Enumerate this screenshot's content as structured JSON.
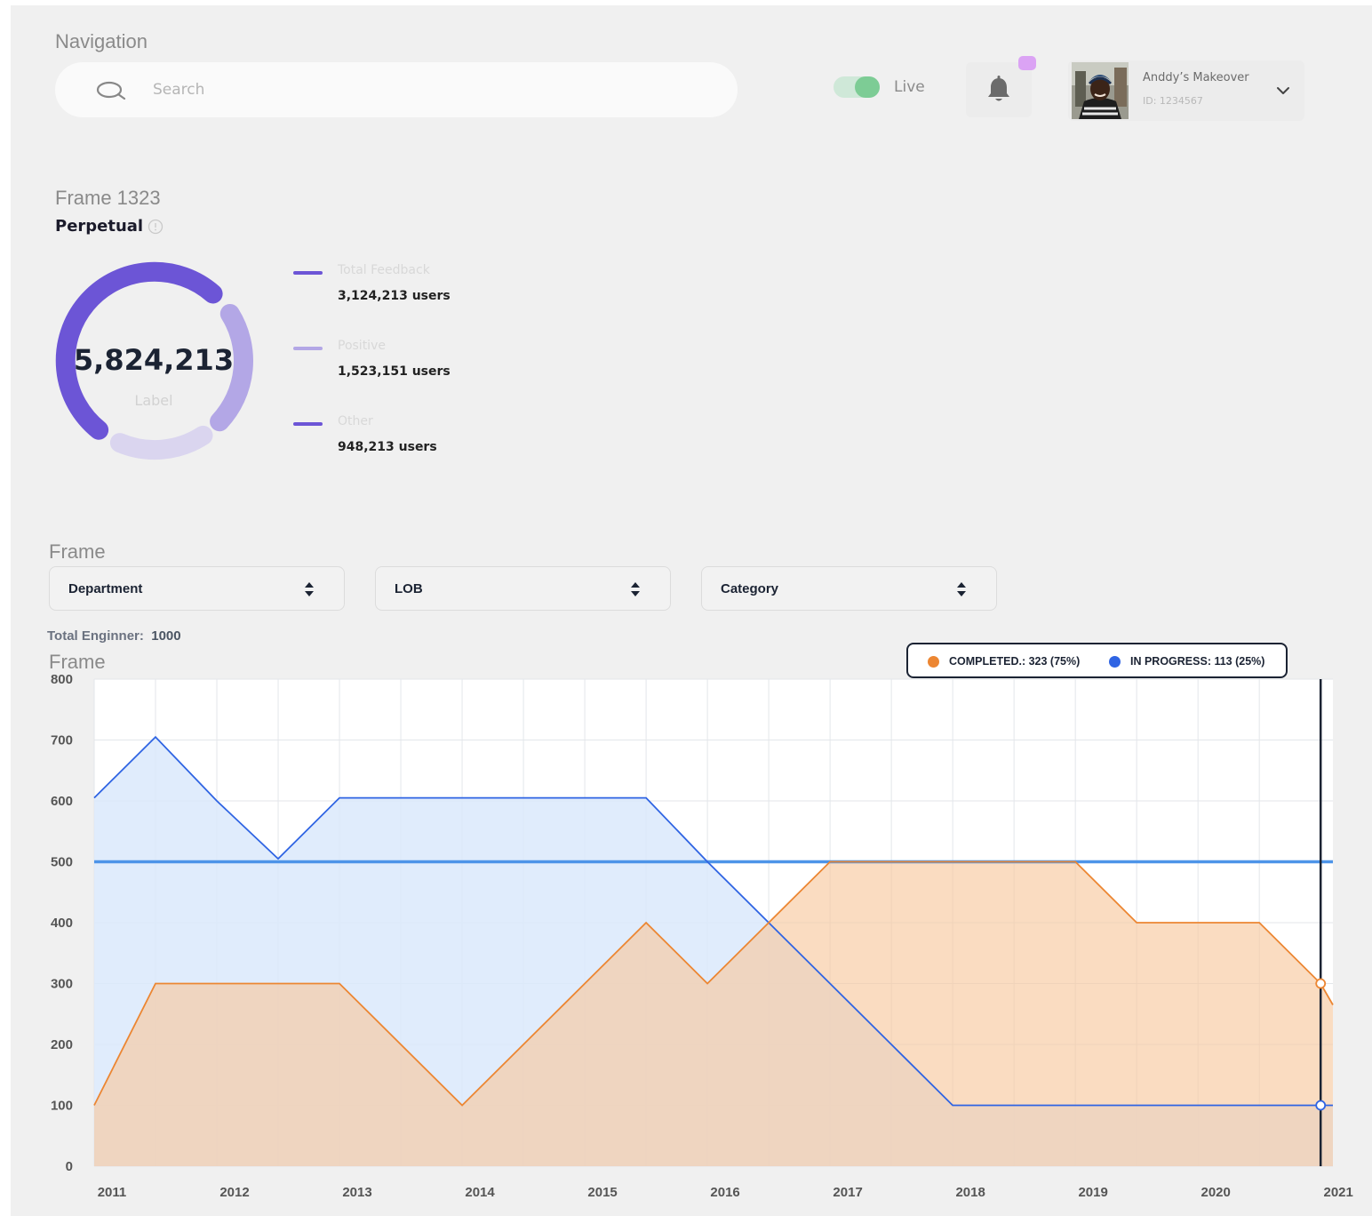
{
  "header": {
    "nav_title": "Navigation",
    "search_placeholder": "Search",
    "live_label": "Live",
    "toggle_on": true,
    "profile_name": "Anddy’s Makeover",
    "profile_id": "ID: 1234567"
  },
  "summary": {
    "title": "Frame 1323",
    "subtitle": "Perpetual",
    "total_value": "5,824,213",
    "total_label": "Label",
    "legend": [
      {
        "name": "Total Feedback",
        "value": "3,124,213 users",
        "color": "#6c55d6"
      },
      {
        "name": "Positive",
        "value": "1,523,151 users",
        "color": "#b3a7e6"
      },
      {
        "name": "Other",
        "value": "948,213 users",
        "color": "#6c55d6"
      }
    ],
    "ring_colors": [
      "#6c55d6",
      "#b3a7e6",
      "#dad5ef"
    ]
  },
  "filters": {
    "title": "Frame",
    "department": "Department",
    "lob": "LOB",
    "category": "Category"
  },
  "chart_section": {
    "total_label": "Total Enginner:",
    "total_value": "1000",
    "title": "Frame",
    "legend_completed": "COMPLETED.: 323 (75%)",
    "legend_in_progress": "IN PROGRESS: 113 (25%)"
  },
  "chart_data": {
    "type": "area",
    "xlabel": "",
    "ylabel": "",
    "ylim": [
      0,
      800
    ],
    "yticks": [
      0,
      100,
      200,
      300,
      400,
      500,
      600,
      700,
      800
    ],
    "xlim": [
      2011,
      2021.1
    ],
    "xticks": [
      2011,
      2012,
      2013,
      2014,
      2015,
      2016,
      2017,
      2018,
      2019,
      2020,
      2021
    ],
    "highlight_x": 2021,
    "reference_line": 500,
    "grid": true,
    "series": [
      {
        "name": "IN PROGRESS",
        "color": "#2f64e3",
        "fill": "#dbe9fb",
        "points": [
          [
            2011.0,
            605
          ],
          [
            2011.5,
            705
          ],
          [
            2012.0,
            600
          ],
          [
            2012.5,
            505
          ],
          [
            2013.0,
            605
          ],
          [
            2014.0,
            605
          ],
          [
            2015.0,
            605
          ],
          [
            2015.5,
            605
          ],
          [
            2016.0,
            500
          ],
          [
            2016.5,
            400
          ],
          [
            2017.0,
            300
          ],
          [
            2017.5,
            200
          ],
          [
            2018.0,
            100
          ],
          [
            2019.0,
            100
          ],
          [
            2020.0,
            100
          ],
          [
            2021.0,
            100
          ],
          [
            2021.1,
            100
          ]
        ]
      },
      {
        "name": "COMPLETED",
        "color": "#ec8632",
        "fill": "#f7c9a0",
        "points": [
          [
            2011.0,
            100
          ],
          [
            2011.5,
            300
          ],
          [
            2012.0,
            300
          ],
          [
            2013.0,
            300
          ],
          [
            2014.0,
            100
          ],
          [
            2015.0,
            300
          ],
          [
            2015.5,
            400
          ],
          [
            2016.0,
            300
          ],
          [
            2016.5,
            400
          ],
          [
            2017.0,
            500
          ],
          [
            2018.0,
            500
          ],
          [
            2019.0,
            500
          ],
          [
            2019.5,
            400
          ],
          [
            2020.0,
            400
          ],
          [
            2020.5,
            400
          ],
          [
            2021.0,
            300
          ],
          [
            2021.1,
            265
          ]
        ]
      }
    ],
    "reference_color": "#4d94e8"
  }
}
